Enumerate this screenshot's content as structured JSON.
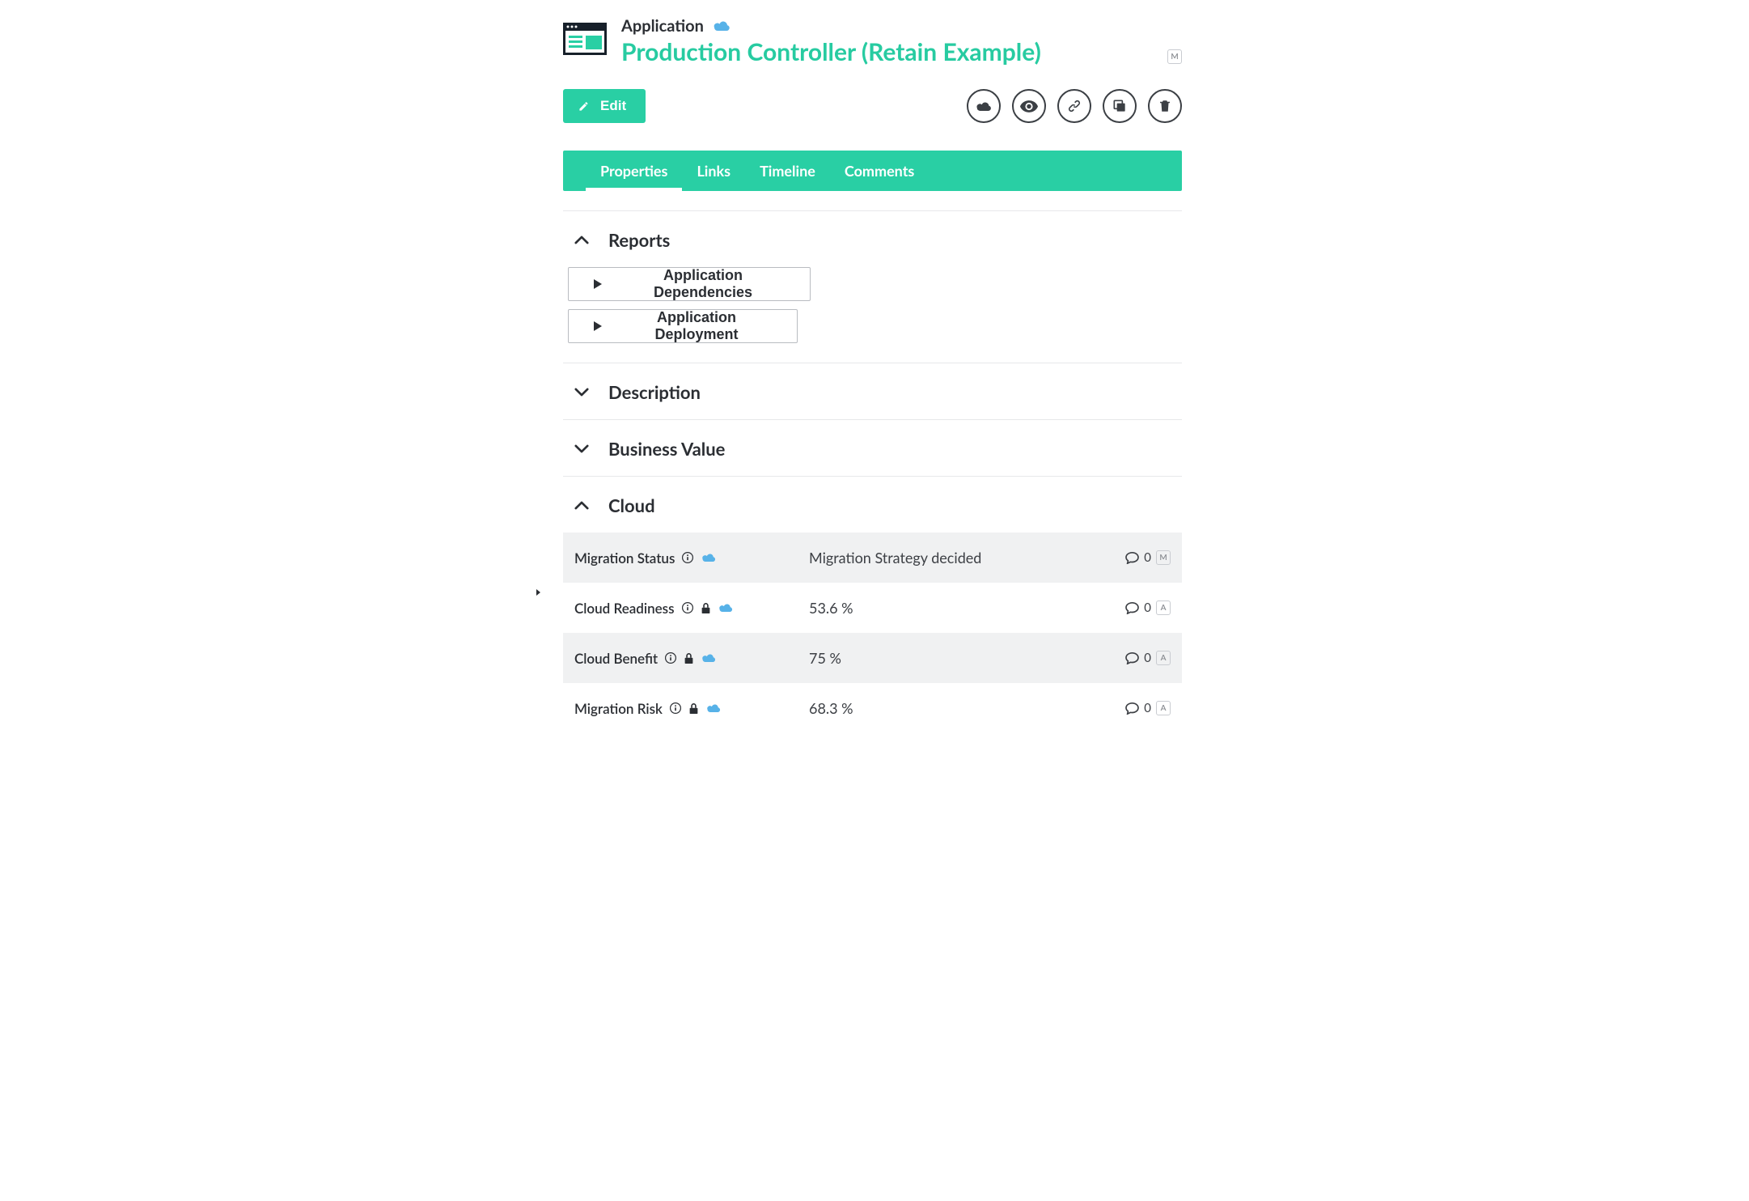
{
  "header": {
    "type_label": "Application",
    "title": "Production Controller (Retain Example)",
    "badge": "M"
  },
  "actions": {
    "edit_label": "Edit"
  },
  "tabs": [
    {
      "label": "Properties",
      "active": true
    },
    {
      "label": "Links",
      "active": false
    },
    {
      "label": "Timeline",
      "active": false
    },
    {
      "label": "Comments",
      "active": false
    }
  ],
  "sections": {
    "reports": {
      "title": "Reports",
      "expanded": true,
      "items": [
        {
          "label": "Application Dependencies"
        },
        {
          "label": "Application Deployment"
        }
      ]
    },
    "description": {
      "title": "Description",
      "expanded": false
    },
    "business_value": {
      "title": "Business Value",
      "expanded": false
    },
    "cloud": {
      "title": "Cloud",
      "expanded": true,
      "rows": [
        {
          "label": "Migration Status",
          "value": "Migration Strategy decided",
          "comments": "0",
          "tag": "M",
          "locked": false,
          "cloud": true
        },
        {
          "label": "Cloud Readiness",
          "value": "53.6 %",
          "comments": "0",
          "tag": "A",
          "locked": true,
          "cloud": true
        },
        {
          "label": "Cloud Benefit",
          "value": "75 %",
          "comments": "0",
          "tag": "A",
          "locked": true,
          "cloud": true
        },
        {
          "label": "Migration Risk",
          "value": "68.3 %",
          "comments": "0",
          "tag": "A",
          "locked": true,
          "cloud": true
        }
      ]
    }
  }
}
